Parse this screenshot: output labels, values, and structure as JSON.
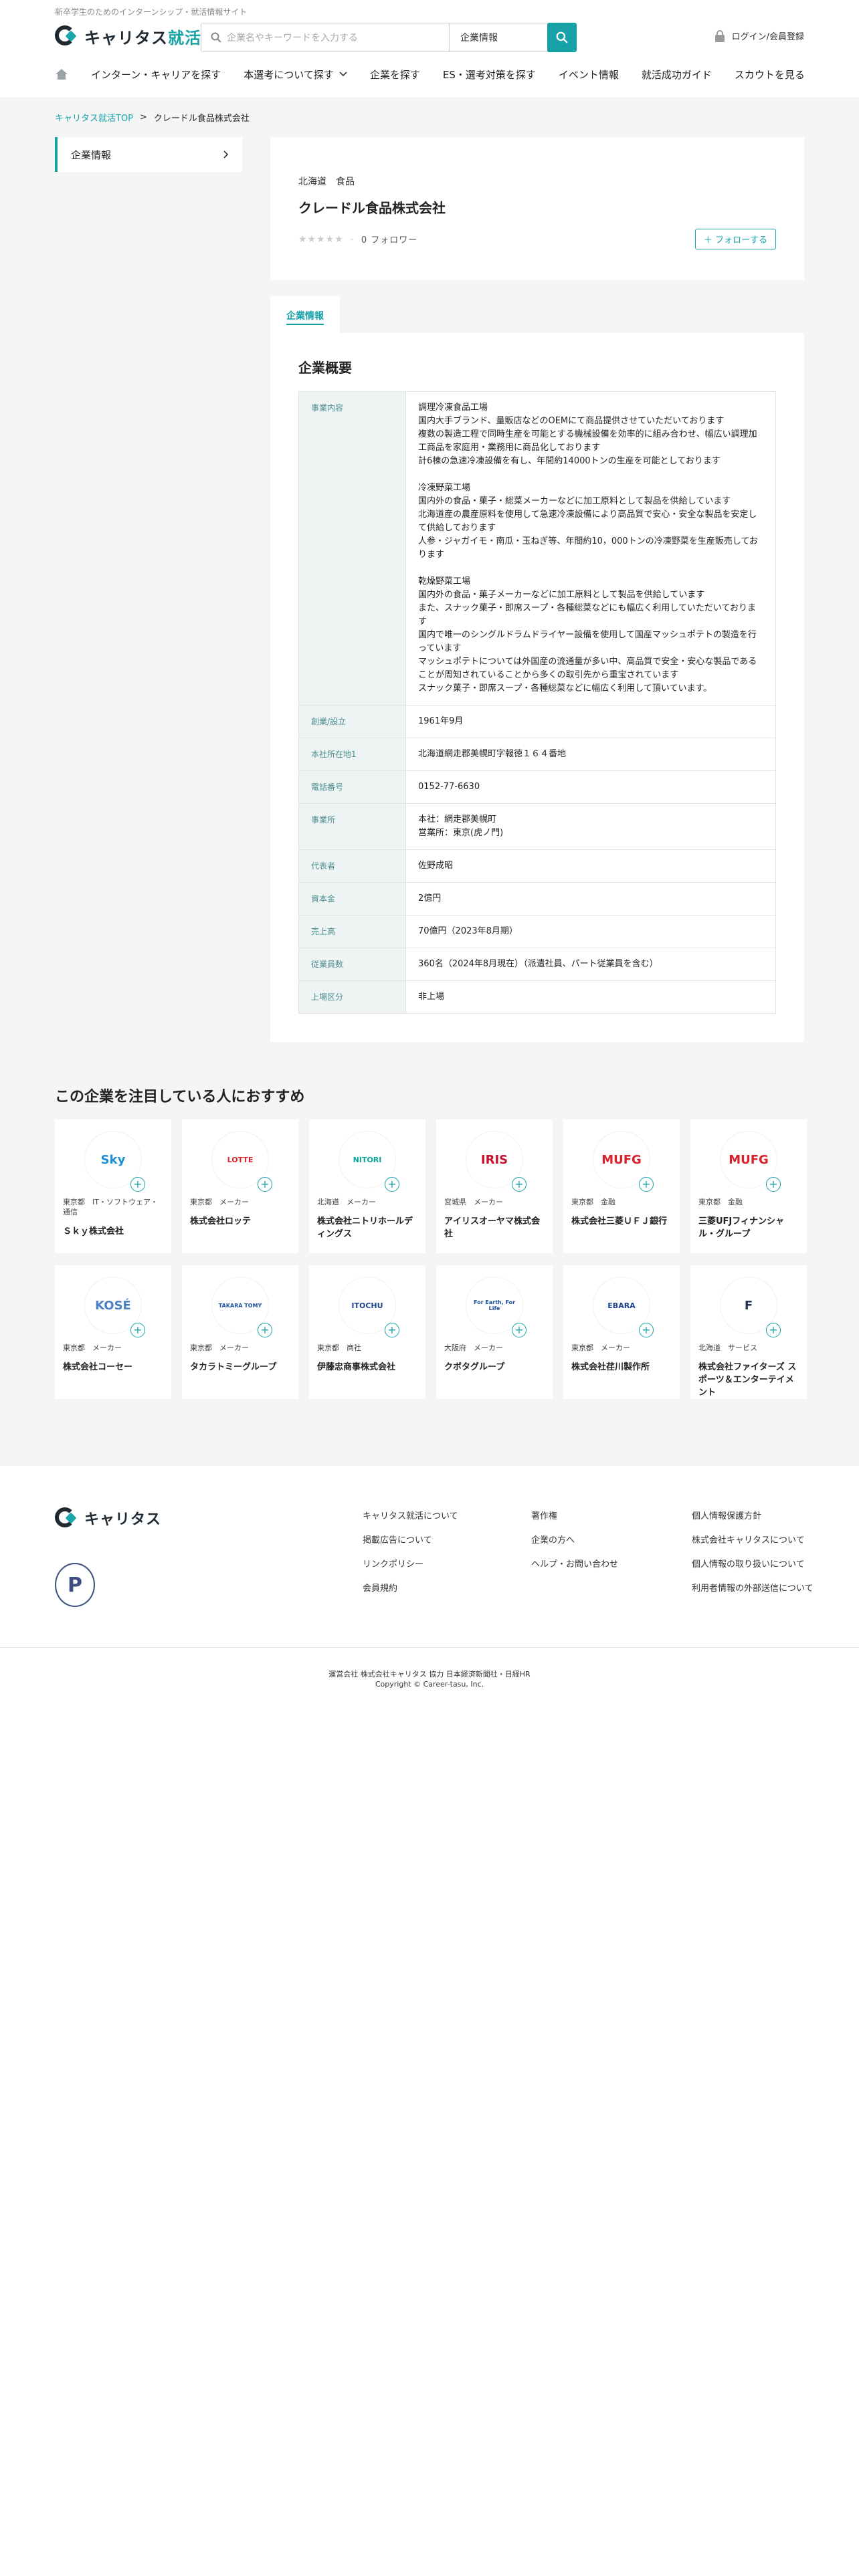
{
  "header": {
    "tagline": "新卒学生のためのインターンシップ・就活情報サイト",
    "logo": {
      "main": "キャリタス",
      "suffix": "就活"
    },
    "search": {
      "placeholder": "企業名やキーワードを入力する",
      "select_value": "企業情報"
    },
    "login_label": "ログイン/会員登録",
    "nav": [
      "インターン・キャリアを探す",
      "本選考について探す",
      "企業を探す",
      "ES・選考対策を探す",
      "イベント情報",
      "就活成功ガイド",
      "スカウトを見る"
    ]
  },
  "breadcrumb": {
    "home": "キャリタス就活TOP",
    "sep": ">",
    "current": "クレードル食品株式会社"
  },
  "sidebar": {
    "item": "企業情報"
  },
  "company": {
    "prefecture": "北海道",
    "industry": "食品",
    "name": "クレードル食品株式会社",
    "stars": "★★★★★",
    "rating_sep": "-",
    "followers": "0 フォロワー",
    "follow_label": "＋ フォローする"
  },
  "tabs": [
    "企業情報"
  ],
  "overview": {
    "title": "企業概要",
    "rows": [
      {
        "key": "事業内容",
        "value": "調理冷凍食品工場\n国内大手ブランド、量販店などのOEMにて商品提供させていただいております\n複数の製造工程で同時生産を可能とする機械設備を効率的に組み合わせ、幅広い調理加工商品を家庭用・業務用に商品化しております\n計6棟の急速冷凍設備を有し、年間約14000トンの生産を可能としております\n\n冷凍野菜工場\n国内外の食品・菓子・総菜メーカーなどに加工原料として製品を供給しています\n北海道産の農産原料を使用して急速冷凍設備により高品質で安心・安全な製品を安定して供給しております\n人参・ジャガイモ・南瓜・玉ねぎ等、年間約10，000トンの冷凍野菜を生産販売しております\n\n乾燥野菜工場\n国内外の食品・菓子メーカーなどに加工原料として製品を供給しています\nまた、スナック菓子・即席スープ・各種総菜などにも幅広く利用していただいております\n国内で唯一のシングルドラムドライヤー設備を使用して国産マッシュポテトの製造を行っています\nマッシュポテトについては外国産の流通量が多い中、高品質で安全・安心な製品であることが周知されていることから多くの取引先から重宝されています\nスナック菓子・即席スープ・各種総菜などに幅広く利用して頂いています。"
      },
      {
        "key": "創業/設立",
        "value": "1961年9月"
      },
      {
        "key": "本社所在地1",
        "value": "北海道網走郡美幌町字報徳１６４番地"
      },
      {
        "key": "電話番号",
        "value": "0152-77-6630"
      },
      {
        "key": "事業所",
        "value": "本社：網走郡美幌町\n営業所：東京(虎ノ門)"
      },
      {
        "key": "代表者",
        "value": "佐野成昭"
      },
      {
        "key": "資本金",
        "value": "2億円"
      },
      {
        "key": "売上高",
        "value": "70億円（2023年8月期）"
      },
      {
        "key": "従業員数",
        "value": "360名（2024年8月現在）（派遣社員、パート従業員を含む）"
      },
      {
        "key": "上場区分",
        "value": "非上場"
      }
    ]
  },
  "recommend": {
    "title": "この企業を注目している人におすすめ",
    "companies": [
      {
        "loc": "東京都　IT・ソフトウェア・通信",
        "name": "Ｓｋｙ株式会社",
        "logo_text": "Sky",
        "color": "#1a8fd6"
      },
      {
        "loc": "東京都　メーカー",
        "name": "株式会社ロッテ",
        "logo_text": "LOTTE",
        "color": "#d8212a"
      },
      {
        "loc": "北海道　メーカー",
        "name": "株式会社ニトリホールディングス",
        "logo_text": "NITORI",
        "color": "#0aa59a"
      },
      {
        "loc": "宮城県　メーカー",
        "name": "アイリスオーヤマ株式会社",
        "logo_text": "IRIS",
        "color": "#c8102e"
      },
      {
        "loc": "東京都　金融",
        "name": "株式会社三菱ＵＦＪ銀行",
        "logo_text": "MUFG",
        "color": "#d8212a"
      },
      {
        "loc": "東京都　金融",
        "name": "三菱UFJフィナンシャル・グループ",
        "logo_text": "MUFG",
        "color": "#d8212a"
      },
      {
        "loc": "東京都　メーカー",
        "name": "株式会社コーセー",
        "logo_text": "KOSÉ",
        "color": "#4a7fc4"
      },
      {
        "loc": "東京都　メーカー",
        "name": "タカラトミーグループ",
        "logo_text": "TAKARA TOMY",
        "color": "#1d4f9c"
      },
      {
        "loc": "東京都　商社",
        "name": "伊藤忠商事株式会社",
        "logo_text": "ITOCHU",
        "color": "#1d3f8c"
      },
      {
        "loc": "大阪府　メーカー",
        "name": "クボタグループ",
        "logo_text": "For Earth, For Life",
        "color": "#1a4f9c"
      },
      {
        "loc": "東京都　メーカー",
        "name": "株式会社荏川製作所",
        "logo_text": "EBARA",
        "color": "#1d3f8c"
      },
      {
        "loc": "北海道　サービス",
        "name": "株式会社ファイターズ スポーツ＆エンターテイメント",
        "logo_text": "F",
        "color": "#1e3558"
      }
    ]
  },
  "footer": {
    "logo": "キャリタス",
    "privacy_mark": "P",
    "col1": [
      "キャリタス就活について",
      "掲載広告について",
      "リンクポリシー",
      "会員規約"
    ],
    "col2": [
      "著作権",
      "企業の方へ",
      "ヘルプ・お問い合わせ"
    ],
    "col3": [
      "個人情報保護方針",
      "株式会社キャリタスについて",
      "個人情報の取り扱いについて",
      "利用者情報の外部送信について"
    ],
    "operator": "運営会社 株式会社キャリタス 協力 日本経済新聞社・日経HR",
    "copyright": "Copyright © Career-tasu, Inc."
  }
}
